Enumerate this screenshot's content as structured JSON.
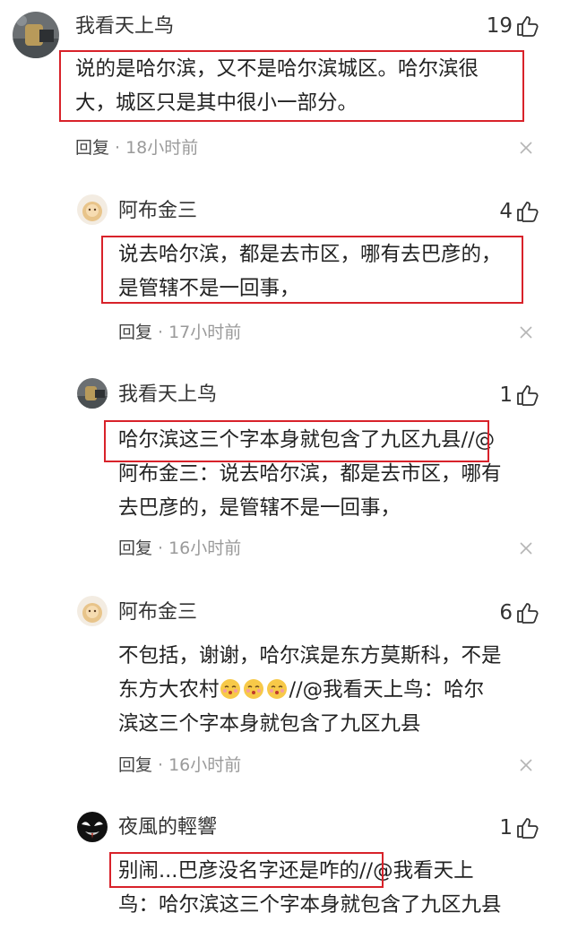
{
  "comments": [
    {
      "username": "我看天上鸟",
      "likes": "19",
      "lines": [
        "说的是哈尔滨，又不是哈尔滨城区。哈尔滨很",
        "大，城区只是其中很小一部分。"
      ],
      "reply_label": "回复",
      "separator": "·",
      "time": "18小时前",
      "avatar_icon": "avatar-photo-icon"
    },
    {
      "username": "阿布金三",
      "likes": "4",
      "lines": [
        "说去哈尔滨，都是去市区，哪有去巴彦的，",
        "是管辖不是一回事，"
      ],
      "reply_label": "回复",
      "separator": "·",
      "time": "17小时前",
      "avatar_icon": "avatar-doll-icon"
    },
    {
      "username": "我看天上鸟",
      "likes": "1",
      "lines": [
        "哈尔滨这三个字本身就包含了九区九县//@",
        "阿布金三：说去哈尔滨，都是去市区，哪有",
        "去巴彦的，是管辖不是一回事，"
      ],
      "reply_label": "回复",
      "separator": "·",
      "time": "16小时前",
      "avatar_icon": "avatar-photo-icon"
    },
    {
      "username": "阿布金三",
      "likes": "6",
      "lines": [
        "不包括，谢谢，哈尔滨是东方莫斯科，不是",
        "东方大农村",
        "滨这三个字本身就包含了九区九县"
      ],
      "line2_suffix": "//@我看天上鸟：哈尔",
      "emoji_names": [
        "kiss-emoji-icon",
        "kiss-emoji-icon",
        "kiss-emoji-icon"
      ],
      "reply_label": "回复",
      "separator": "·",
      "time": "16小时前",
      "avatar_icon": "avatar-doll-icon"
    },
    {
      "username": "夜風的輕響",
      "likes": "1",
      "lines": [
        "别闹...巴彦没名字还是咋的//@我看天上",
        "鸟：哈尔滨这三个字本身就包含了九区九县"
      ],
      "avatar_icon": "avatar-venom-icon"
    }
  ],
  "colors": {
    "highlight_border": "#d8222a",
    "meta_gray": "#9a9a9a",
    "text": "#222222"
  }
}
